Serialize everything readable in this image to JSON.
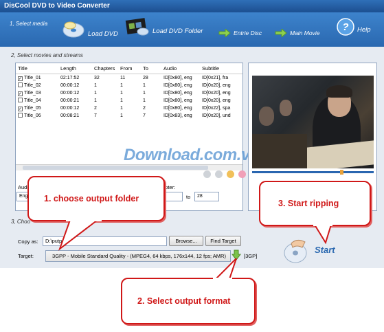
{
  "window": {
    "title": "DisCool DVD to Video Converter"
  },
  "header": {
    "step1": "1, Select media",
    "load_dvd": "Load DVD",
    "load_dvd_folder": "Load DVD Folder",
    "entire_disc": "Entrie Disc",
    "main_movie": "Main Movie",
    "help": "Help"
  },
  "step2": {
    "label": "2, Select movies and streams"
  },
  "table": {
    "headers": [
      "Title",
      "Length",
      "Chapters",
      "From",
      "To",
      "Audio",
      "Subtitle"
    ],
    "rows": [
      {
        "checked": true,
        "cells": [
          "Title_01",
          "02:17:52",
          "32",
          "11",
          "28",
          "ID[0x80], eng",
          "ID[0x21], fra"
        ]
      },
      {
        "checked": false,
        "cells": [
          "Title_02",
          "00:00:12",
          "1",
          "1",
          "1",
          "ID[0x80], eng",
          "ID[0x20], eng"
        ]
      },
      {
        "checked": true,
        "cells": [
          "Title_03",
          "00:00:12",
          "1",
          "1",
          "1",
          "ID[0x80], eng",
          "ID[0x20], eng"
        ]
      },
      {
        "checked": false,
        "cells": [
          "Title_04",
          "00:00:21",
          "1",
          "1",
          "1",
          "ID[0x80], eng",
          "ID[0x20], eng"
        ]
      },
      {
        "checked": true,
        "cells": [
          "Title_05",
          "00:00:12",
          "2",
          "1",
          "2",
          "ID[0x80], eng",
          "ID[0x22], spa"
        ]
      },
      {
        "checked": false,
        "cells": [
          "Title_06",
          "00:08:21",
          "7",
          "1",
          "7",
          "ID[0x83], eng",
          "ID[0x20], und"
        ]
      }
    ]
  },
  "controls": {
    "audio_label": "Audi",
    "audio_value": "Engl",
    "chapter_label": "apter:",
    "from_value": "",
    "to_label": "to",
    "to_value": "28"
  },
  "step3": {
    "label": "3, Choo"
  },
  "output": {
    "copy_as_label": "Copy as:",
    "copy_as_value": "D:\\putput\\",
    "browse": "Browse...",
    "find_target": "Find Target",
    "target_label": "Target:",
    "target_value": "3GPP - Mobile Standard Quality - (MPEG4, 64 kbps, 176x144, 12 fps; AMR)",
    "target_ext": "[3GP]",
    "start": "Start"
  },
  "watermark": "Download.com.vn",
  "callouts": {
    "c1": "1. choose output folder",
    "c2": "2. Select output format",
    "c3": "3. Start ripping"
  },
  "colors": {
    "accent": "#2a68b0",
    "callout": "#d01818"
  }
}
